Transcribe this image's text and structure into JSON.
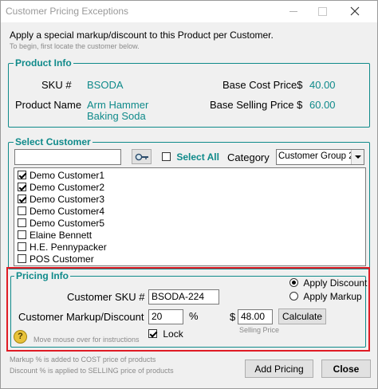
{
  "window": {
    "title": "Customer Pricing Exceptions"
  },
  "intro": {
    "line1": "Apply a special markup/discount to this Product per Customer.",
    "line2": "To begin, first locate the customer below."
  },
  "product_info": {
    "legend": "Product Info",
    "sku_label": "SKU #",
    "sku_value": "BSODA",
    "name_label": "Product Name",
    "name_line1": "Arm  Hammer",
    "name_line2": "Baking Soda",
    "base_cost_label": "Base Cost Price$",
    "base_cost_value": "40.00",
    "base_selling_label": "Base Selling Price $",
    "base_selling_value": "60.00"
  },
  "select_customer": {
    "legend": "Select Customer",
    "search_value": "",
    "select_all_label": "Select All",
    "select_all_checked": false,
    "category_label": "Category",
    "category_selected": "Customer Group 2",
    "customers": [
      {
        "name": "Demo Customer1",
        "checked": true
      },
      {
        "name": "Demo Customer2",
        "checked": true
      },
      {
        "name": "Demo Customer3",
        "checked": true
      },
      {
        "name": "Demo Customer4",
        "checked": false
      },
      {
        "name": "Demo Customer5",
        "checked": false
      },
      {
        "name": "Elaine Bennett",
        "checked": false
      },
      {
        "name": "H.E. Pennypacker",
        "checked": false
      },
      {
        "name": "POS Customer",
        "checked": false
      }
    ]
  },
  "pricing_info": {
    "legend": "Pricing Info",
    "customer_sku_label": "Customer SKU #",
    "customer_sku_value": "BSODA-224",
    "markup_label": "Customer Markup/Discount",
    "markup_value": "20",
    "percent_symbol": "%",
    "dollar_symbol": "$",
    "price_value": "48.00",
    "selling_price_caption": "Selling Price",
    "calculate_label": "Calculate",
    "lock_label": "Lock",
    "lock_checked": true,
    "apply_discount_label": "Apply Discount",
    "apply_markup_label": "Apply Markup",
    "mode_selected": "discount",
    "help_icon": "?",
    "help_text": "Move mouse over for instructions"
  },
  "footer": {
    "note1": "Markup % is added to COST price of products",
    "note2": "Discount % is applied to SELLING price of products",
    "add_pricing_label": "Add Pricing",
    "close_label": "Close"
  },
  "colors": {
    "accent": "#0f8a8a",
    "highlight": "#e01b24"
  }
}
